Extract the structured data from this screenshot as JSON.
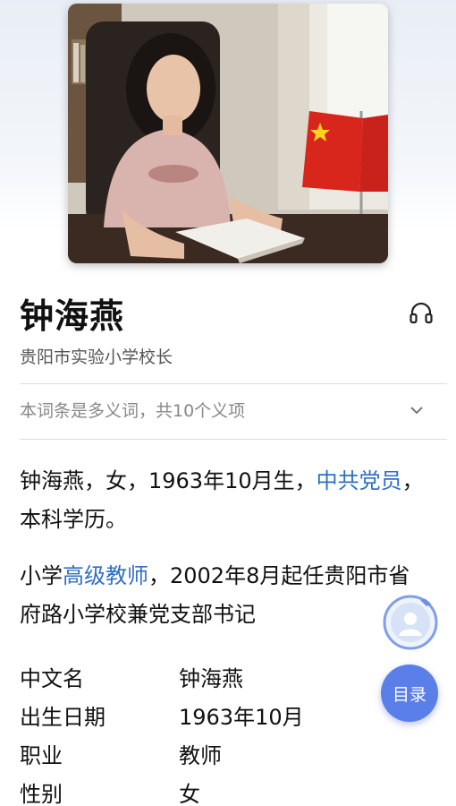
{
  "entry": {
    "name": "钟海燕",
    "subtitle": "贵阳市实验小学校长",
    "polysemy_note": "本词条是多义词，共10个义项"
  },
  "summary": {
    "p1_text1": "钟海燕，女，1963年10月生，",
    "p1_link": "中共党员",
    "p1_text2": "，本科学历。",
    "p2_text1": "小学",
    "p2_link": "高级教师",
    "p2_text2": "，2002年8月起任贵阳市省府路小学校兼党支部书记"
  },
  "infobox": [
    {
      "key": "中文名",
      "value": "钟海燕"
    },
    {
      "key": "出生日期",
      "value": "1963年10月"
    },
    {
      "key": "职业",
      "value": "教师"
    },
    {
      "key": "性别",
      "value": "女"
    }
  ],
  "floating": {
    "toc_label": "目录"
  },
  "icons": {
    "listen": "headphones-icon",
    "expand": "chevron-down-icon",
    "assistant": "avatar-assistant-icon"
  },
  "colors": {
    "link": "#2f6fc5",
    "toc_button": "#5b7fe8"
  }
}
